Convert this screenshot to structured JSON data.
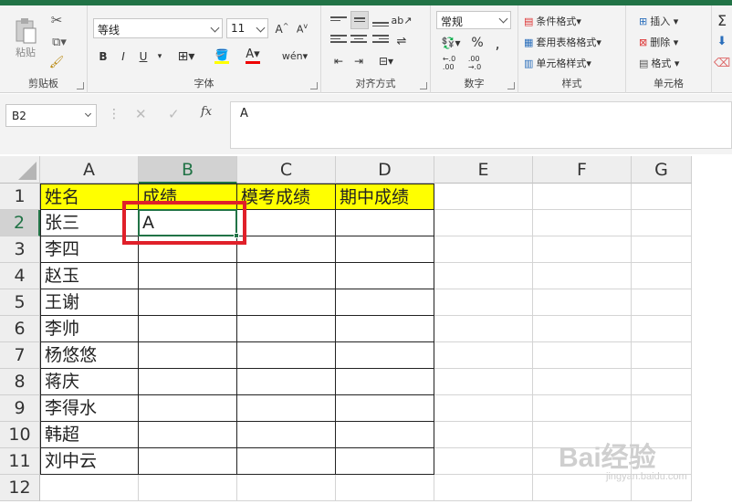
{
  "colors": {
    "accent": "#217346",
    "header_fill": "#ffff00",
    "highlight_box": "#e0202a"
  },
  "ribbon": {
    "clipboard": {
      "paste_label": "粘贴",
      "group_label": "剪贴板"
    },
    "font": {
      "font_name": "等线",
      "font_size": "11",
      "bold": "B",
      "italic": "I",
      "underline": "U",
      "group_label": "字体"
    },
    "alignment": {
      "group_label": "对齐方式"
    },
    "number": {
      "format": "常规",
      "percent": "%",
      "group_label": "数字"
    },
    "styles": {
      "conditional": "条件格式",
      "table": "套用表格格式",
      "cell": "单元格样式",
      "group_label": "样式"
    },
    "cells": {
      "insert": "插入",
      "delete": "删除",
      "format": "格式",
      "group_label": "单元格"
    }
  },
  "formula_bar": {
    "name_box": "B2",
    "fx": "fx",
    "content": "A"
  },
  "sheet": {
    "columns": [
      "A",
      "B",
      "C",
      "D",
      "E",
      "F",
      "G"
    ],
    "rows": [
      "1",
      "2",
      "3",
      "4",
      "5",
      "6",
      "7",
      "8",
      "9",
      "10",
      "11",
      "12"
    ],
    "cells": {
      "A1": "姓名",
      "B1": "成绩",
      "C1": "模考成绩",
      "D1": "期中成绩",
      "A2": "张三",
      "B2": "A",
      "A3": "李四",
      "A4": "赵玉",
      "A5": "王谢",
      "A6": "李帅",
      "A7": "杨悠悠",
      "A8": "蒋庆",
      "A9": "李得水",
      "A10": "韩超",
      "A11": "刘中云"
    }
  },
  "watermark": {
    "brand": "Bai经验",
    "url": "jingyan.baidu.com"
  }
}
